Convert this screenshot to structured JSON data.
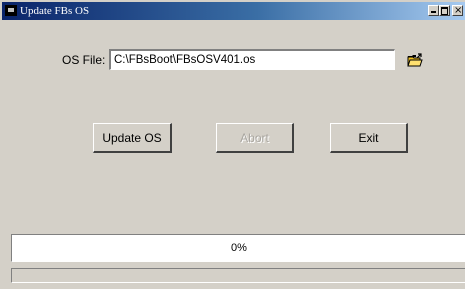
{
  "window": {
    "title": "Update FBs OS"
  },
  "form": {
    "os_file_label": "OS File:",
    "os_file_value": "C:\\FBsBoot\\FBsOSV401.os",
    "browse_icon": "open-folder-icon"
  },
  "buttons": {
    "update_label": "Update OS",
    "abort_label": "Abort",
    "exit_label": "Exit"
  },
  "progress": {
    "text": "0%",
    "value": 0
  },
  "colors": {
    "face": "#d4d0c8",
    "title_start": "#0a246a",
    "title_end": "#a6caf0",
    "disabled_text": "#a9a6a0"
  }
}
